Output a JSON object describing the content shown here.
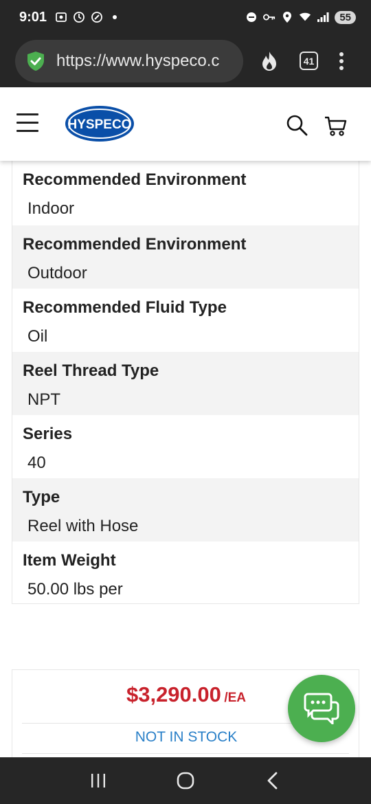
{
  "status_bar": {
    "time": "9:01",
    "battery": "55"
  },
  "browser": {
    "url": "https://www.hyspeco.c",
    "tab_count": "41"
  },
  "header": {
    "logo_text": "HYSPECO",
    "brand_color": "#0a4fa8"
  },
  "specs": [
    {
      "label": "Recommended Environment",
      "value": "Indoor"
    },
    {
      "label": "Recommended Environment",
      "value": "Outdoor"
    },
    {
      "label": "Recommended Fluid Type",
      "value": "Oil"
    },
    {
      "label": "Reel Thread Type",
      "value": "NPT"
    },
    {
      "label": "Series",
      "value": "40"
    },
    {
      "label": "Type",
      "value": "Reel with Hose"
    },
    {
      "label": "Item Weight",
      "value": "50.00 lbs per"
    }
  ],
  "pricing": {
    "price": "$3,290.00",
    "unit": "/EA",
    "stock_status": "NOT IN STOCK",
    "price_color": "#c8222c",
    "stock_color": "#2a80c8"
  },
  "chat": {
    "icon": "chat-bubbles-icon",
    "color": "#4caf50"
  },
  "nav": {
    "icons": [
      "recent-apps-icon",
      "home-icon",
      "back-icon"
    ]
  }
}
